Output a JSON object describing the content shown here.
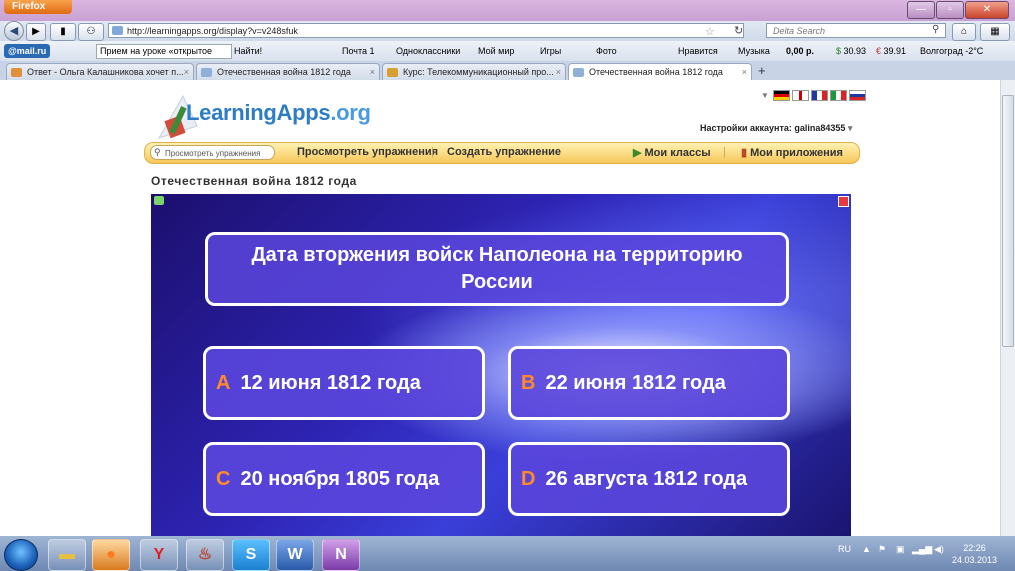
{
  "browser": {
    "menu_label": "Firefox",
    "url": "http://learningapps.org/display?v=v248sfuk",
    "search_placeholder": "Delta Search"
  },
  "mail_toolbar": {
    "logo": "@mail.ru",
    "lesson_text": "Прием на уроке «открытое",
    "find_label": "Найти!",
    "mail_label": "Почта 1",
    "classmates_label": "Одноклассники",
    "myworld_label": "Мой мир",
    "games_label": "Игры",
    "photo_label": "Фото",
    "likes_label": "Нравится",
    "music_label": "Музыка",
    "money_label": "0,00 р.",
    "usd_rate": "30.93",
    "eur_rate": "39.91",
    "weather_label": "Волгоград -2°C"
  },
  "tabs": [
    {
      "label": "Ответ - Ольга Калашникова хочет п..."
    },
    {
      "label": "Отечественная война 1812 года"
    },
    {
      "label": "Курс: Телекоммуникационный про..."
    },
    {
      "label": "Отечественная война 1812 года"
    }
  ],
  "site": {
    "logo_text": "LearningApps",
    "logo_suffix": ".org",
    "account_label": "Настройки аккаунта: galina84355",
    "search_placeholder": "Просмотреть упражнения",
    "nav": {
      "browse": "Просмотреть упражнения",
      "create": "Создать упражнение",
      "classes": "Мои классы",
      "apps": "Мои приложения"
    },
    "page_title": "Отечественная война 1812 года"
  },
  "quiz": {
    "question": "Дата вторжения войск Наполеона на территорию России",
    "answers": [
      {
        "letter": "A",
        "text": "12 июня 1812 года"
      },
      {
        "letter": "B",
        "text": "22 июня 1812 года"
      },
      {
        "letter": "C",
        "text": "20 ноября 1805 года"
      },
      {
        "letter": "D",
        "text": "26 августа 1812 года"
      }
    ]
  },
  "taskbar": {
    "lang": "RU",
    "time": "22:26",
    "date": "24.03.2013"
  },
  "colors": {
    "answer_letter": "#ff8a2a",
    "quiz_bg": "#2e24b5",
    "logo_blue": "#2d7cc5"
  }
}
